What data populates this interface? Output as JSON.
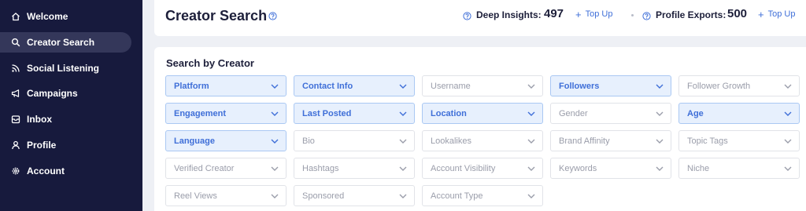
{
  "sidebar": {
    "items": [
      {
        "label": "Welcome",
        "icon": "home-icon",
        "active": false
      },
      {
        "label": "Creator Search",
        "icon": "search-icon",
        "active": true
      },
      {
        "label": "Social Listening",
        "icon": "rss-icon",
        "active": false
      },
      {
        "label": "Campaigns",
        "icon": "megaphone-icon",
        "active": false
      },
      {
        "label": "Inbox",
        "icon": "inbox-icon",
        "active": false
      },
      {
        "label": "Profile",
        "icon": "user-icon",
        "active": false
      },
      {
        "label": "Account",
        "icon": "gear-icon",
        "active": false
      }
    ]
  },
  "header": {
    "title": "Creator Search",
    "deep_insights": {
      "label": "Deep Insights:",
      "value": "497",
      "topup": "Top Up"
    },
    "profile_exports": {
      "label": "Profile Exports:",
      "value": "500",
      "topup": "Top Up"
    }
  },
  "search": {
    "title": "Search by Creator",
    "filters": [
      {
        "label": "Platform",
        "active": true
      },
      {
        "label": "Contact Info",
        "active": true
      },
      {
        "label": "Username",
        "active": false
      },
      {
        "label": "Followers",
        "active": true
      },
      {
        "label": "Follower Growth",
        "active": false
      },
      {
        "label": "Engagement",
        "active": true
      },
      {
        "label": "Last Posted",
        "active": true
      },
      {
        "label": "Location",
        "active": true
      },
      {
        "label": "Gender",
        "active": false
      },
      {
        "label": "Age",
        "active": true
      },
      {
        "label": "Language",
        "active": true
      },
      {
        "label": "Bio",
        "active": false
      },
      {
        "label": "Lookalikes",
        "active": false
      },
      {
        "label": "Brand Affinity",
        "active": false
      },
      {
        "label": "Topic Tags",
        "active": false
      },
      {
        "label": "Verified Creator",
        "active": false
      },
      {
        "label": "Hashtags",
        "active": false
      },
      {
        "label": "Account Visibility",
        "active": false
      },
      {
        "label": "Keywords",
        "active": false
      },
      {
        "label": "Niche",
        "active": false
      },
      {
        "label": "Reel Views",
        "active": false
      },
      {
        "label": "Sponsored",
        "active": false
      },
      {
        "label": "Account Type",
        "active": false
      }
    ]
  },
  "colors": {
    "sidebar_bg": "#171a3d",
    "sidebar_active": "#34375a",
    "accent": "#3f6fd8",
    "active_filter_bg": "#e7f0fd"
  }
}
